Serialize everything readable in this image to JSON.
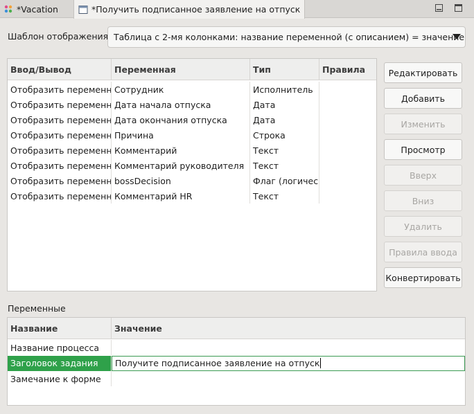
{
  "tabs": [
    {
      "label": "*Vacation",
      "icon": "process-icon"
    },
    {
      "label": "*Получить подписанное заявление на отпуск",
      "icon": "form-icon"
    }
  ],
  "template": {
    "label": "Шаблон отображения",
    "value": "Таблица с 2-мя колонками: название переменной (с описанием) = значение"
  },
  "variables_table": {
    "columns": [
      "Ввод/Вывод",
      "Переменная",
      "Тип",
      "Правила"
    ],
    "rows": [
      [
        "Отобразить переменную",
        "Сотрудник",
        "Исполнитель",
        ""
      ],
      [
        "Отобразить переменную",
        "Дата начала отпуска",
        "Дата",
        ""
      ],
      [
        "Отобразить переменную",
        "Дата окончания отпуска",
        "Дата",
        ""
      ],
      [
        "Отобразить переменную",
        "Причина",
        "Строка",
        ""
      ],
      [
        "Отобразить переменную",
        "Комментарий",
        "Текст",
        ""
      ],
      [
        "Отобразить переменную",
        "Комментарий руководителя",
        "Текст",
        ""
      ],
      [
        "Отобразить переменную",
        "bossDecision",
        "Флаг (логический)",
        ""
      ],
      [
        "Отобразить переменную",
        "Комментарий HR",
        "Текст",
        ""
      ]
    ]
  },
  "buttons": [
    {
      "label": "Редактировать",
      "enabled": true
    },
    {
      "label": "Добавить",
      "enabled": true
    },
    {
      "label": "Изменить",
      "enabled": false
    },
    {
      "label": "Просмотр",
      "enabled": true
    },
    {
      "label": "Вверх",
      "enabled": false
    },
    {
      "label": "Вниз",
      "enabled": false
    },
    {
      "label": "Удалить",
      "enabled": false
    },
    {
      "label": "Правила ввода",
      "enabled": false
    },
    {
      "label": "Конвертировать",
      "enabled": true
    }
  ],
  "variables_section": {
    "label": "Переменные",
    "columns": [
      "Название",
      "Значение"
    ],
    "rows": [
      {
        "name": "Название процесса",
        "value": ""
      },
      {
        "name": "Заголовок задания",
        "value": "Получите подписанное заявление на отпуск",
        "selected": true
      },
      {
        "name": "Замечание к форме",
        "value": ""
      }
    ]
  },
  "colors": {
    "selection": "#2fa14a",
    "background": "#e8e6e3"
  }
}
